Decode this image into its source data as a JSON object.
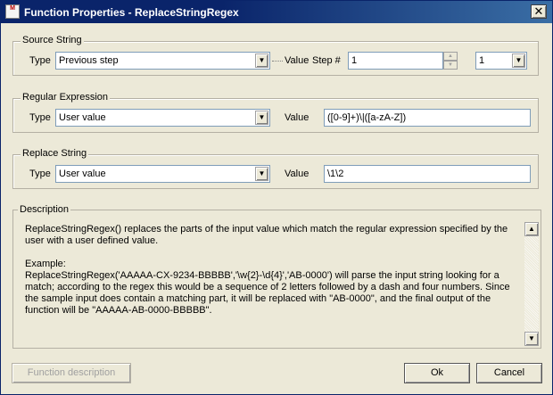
{
  "window": {
    "title": "Function Properties - ReplaceStringRegex",
    "close_label": "✕",
    "app_icon_text": "M"
  },
  "source_string": {
    "group_label": "Source String",
    "type_label": "Type",
    "type_value": "Previous step",
    "value_label": "Value",
    "step_label": "Step #",
    "step_value": "1",
    "step_combo_value": "1"
  },
  "regular_expression": {
    "group_label": "Regular Expression",
    "type_label": "Type",
    "type_value": "User value",
    "value_label": "Value",
    "value": "([0-9]+)\\|([a-zA-Z])"
  },
  "replace_string": {
    "group_label": "Replace String",
    "type_label": "Type",
    "type_value": "User value",
    "value_label": "Value",
    "value": "\\1\\2"
  },
  "description": {
    "group_label": "Description",
    "paragraph1": "ReplaceStringRegex() replaces the parts of the input value which match the regular expression specified by the user with a user defined value.",
    "paragraph2": "Example:\nReplaceStringRegex('AAAAA-CX-9234-BBBBB','\\w{2}-\\d{4}','AB-0000') will parse the input string looking for a match; according to the regex this would be a sequence of 2 letters followed by a dash and four numbers. Since the sample input does contain a matching part, it will be replaced with \"AB-0000\", and the final output of the function will be \"AAAAA-AB-0000-BBBBB\"."
  },
  "buttons": {
    "function_description": "Function description",
    "ok": "Ok",
    "cancel": "Cancel"
  }
}
